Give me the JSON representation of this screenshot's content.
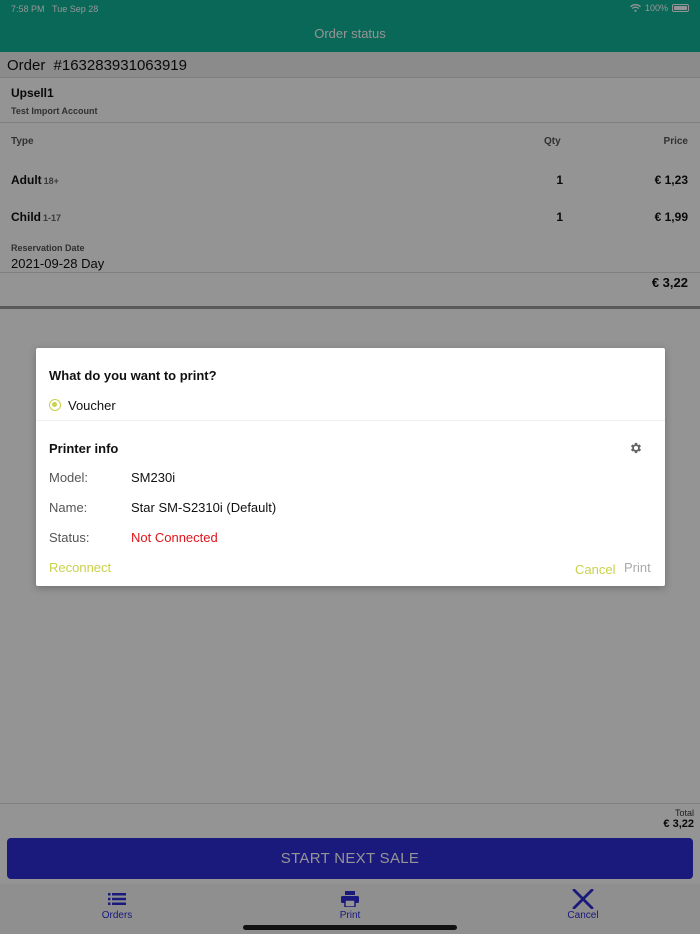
{
  "status_bar": {
    "time": "7:58 PM",
    "date": "Tue Sep 28",
    "battery": "100%"
  },
  "header": {
    "title": "Order status"
  },
  "order": {
    "label": "Order",
    "number": "#163283931063919",
    "account_name": "Upsell1",
    "account_sub": "Test Import Account",
    "columns": {
      "type": "Type",
      "qty": "Qty",
      "price": "Price"
    },
    "rows": [
      {
        "type": "Adult",
        "age": "18+",
        "qty": "1",
        "price": "€ 1,23"
      },
      {
        "type": "Child",
        "age": "1-17",
        "qty": "1",
        "price": "€ 1,99"
      }
    ],
    "reservation_label": "Reservation Date",
    "reservation_value": "2021-09-28 Day",
    "subtotal": "€ 3,22"
  },
  "total": {
    "label": "Total",
    "value": "€ 3,22"
  },
  "start_button": "START NEXT SALE",
  "tabs": [
    {
      "label": "Orders",
      "icon": "list-icon"
    },
    {
      "label": "Print",
      "icon": "printer-icon"
    },
    {
      "label": "Cancel",
      "icon": "close-icon"
    }
  ],
  "dialog": {
    "title": "What do you want to print?",
    "option": "Voucher",
    "printer_info_title": "Printer info",
    "fields": [
      {
        "key": "Model:",
        "value": "SM230i"
      },
      {
        "key": "Name:",
        "value": "Star SM-S2310i (Default)"
      },
      {
        "key": "Status:",
        "value": "Not Connected"
      }
    ],
    "reconnect": "Reconnect",
    "cancel": "Cancel",
    "print": "Print"
  },
  "colors": {
    "header": "#12b39a",
    "primary": "#2e2bd6",
    "accent": "#c9d14a",
    "error": "#e0151b"
  }
}
